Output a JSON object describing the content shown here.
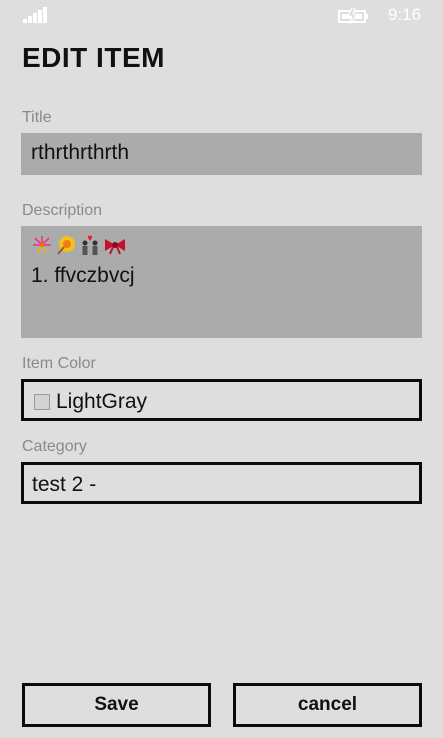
{
  "status_bar": {
    "time": "9:16",
    "signal_icon": "signal-strength-icon",
    "battery_icon": "battery-charging-icon"
  },
  "page": {
    "title": "EDIT ITEM"
  },
  "form": {
    "title_label": "Title",
    "title_value": "rthrthrthrth",
    "description_label": "Description",
    "description_emojis": [
      "fireworks",
      "moon-cake",
      "couple",
      "ribbon-bow"
    ],
    "description_value": "1. ffvczbvcj",
    "item_color_label": "Item Color",
    "item_color_value": "LightGray",
    "item_color_swatch": "#d3d3d3",
    "category_label": "Category",
    "category_value": "test 2 -"
  },
  "actions": {
    "save_label": "Save",
    "cancel_label": "cancel"
  },
  "colors": {
    "background": "#dedede",
    "input_fill": "#ababab",
    "border": "#0a0a0a",
    "label_text": "#8a8a8a"
  }
}
